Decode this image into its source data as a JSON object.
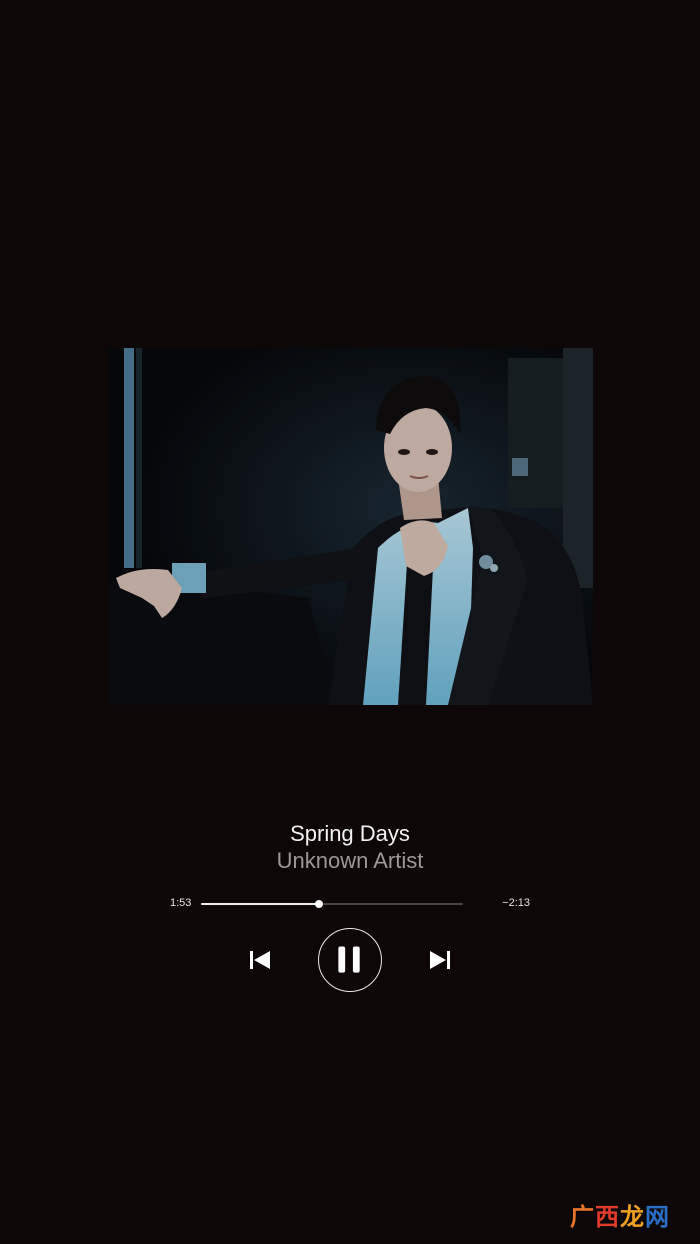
{
  "track": {
    "title": "Spring Days",
    "artist": "Unknown Artist"
  },
  "playback": {
    "elapsed": "1:53",
    "remaining": "−2:13",
    "progress_fraction": 0.45,
    "state": "playing"
  },
  "controls": {
    "previous_icon": "skip-previous-icon",
    "pause_icon": "pause-icon",
    "next_icon": "skip-next-icon"
  },
  "artwork": {
    "description_icon": "album-art-image"
  },
  "watermark": {
    "text": "广西龙网",
    "colors": [
      "#e8732a",
      "#e03a2a",
      "#f0a020",
      "#2a6ec8"
    ]
  },
  "colors": {
    "background": "#0d0807",
    "primary_text": "#f2f2f2",
    "secondary_text": "#9c9896",
    "accent": "#ffffff"
  }
}
